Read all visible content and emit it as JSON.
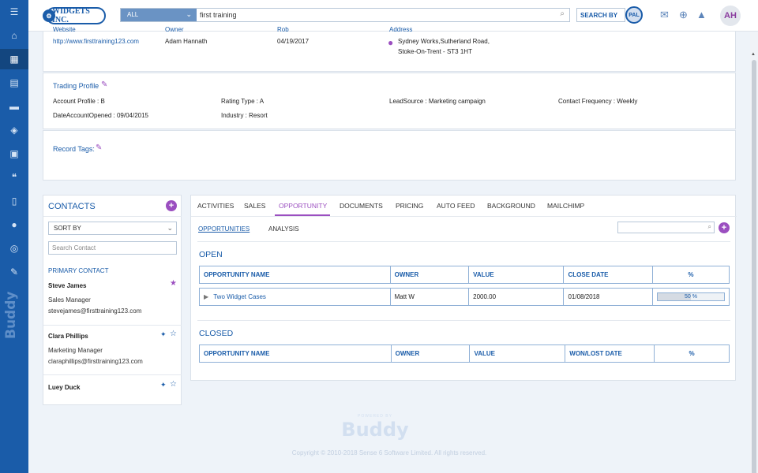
{
  "header": {
    "brand": "WIDGETS INC.",
    "search_scope": "ALL",
    "search_value": "first training",
    "search_by_label": "SEARCH BY",
    "pal_label": "PAL",
    "user_initials": "AH"
  },
  "account": {
    "website_label": "Website",
    "website_value": "http://www.firsttraining123.com",
    "owner_label": "Owner",
    "owner_value": "Adam Hannath",
    "rob_label": "Rob",
    "rob_value": "04/19/2017",
    "address_label": "Address",
    "address_line1": "Sydney Works,Sutherland Road,",
    "address_line2": "Stoke-On-Trent - ST3 1HT"
  },
  "trading_profile": {
    "title": "Trading Profile",
    "account_profile_label": "Account Profile :",
    "account_profile_value": "B",
    "rating_type_label": "Rating Type :",
    "rating_type_value": "A",
    "lead_source_label": "LeadSource :",
    "lead_source_value": "Marketing campaign",
    "contact_frequency_label": "Contact Frequency :",
    "contact_frequency_value": "Weekly",
    "date_opened_label": "DateAccountOpened :",
    "date_opened_value": "09/04/2015",
    "industry_label": "Industry :",
    "industry_value": "Resort"
  },
  "record_tags": {
    "title": "Record Tags:"
  },
  "contacts": {
    "title": "CONTACTS",
    "sort_by": "SORT BY",
    "search_placeholder": "Search Contact",
    "primary_label": "PRIMARY CONTACT",
    "items": [
      {
        "name": "Steve James",
        "role": "Sales Manager",
        "email": "stevejames@firsttraining123.com"
      },
      {
        "name": "Clara Phillips",
        "role": "Marketing Manager",
        "email": "claraphillips@firsttraining123.com"
      },
      {
        "name": "Luey Duck"
      }
    ]
  },
  "tabs": [
    {
      "label": "ACTIVITIES"
    },
    {
      "label": "SALES"
    },
    {
      "label": "OPPORTUNITY"
    },
    {
      "label": "DOCUMENTS"
    },
    {
      "label": "PRICING"
    },
    {
      "label": "AUTO FEED"
    },
    {
      "label": "BACKGROUND"
    },
    {
      "label": "MAILCHIMP"
    }
  ],
  "subtabs": [
    {
      "label": "OPPORTUNITIES"
    },
    {
      "label": "ANALYSIS"
    }
  ],
  "open": {
    "title": "OPEN",
    "columns": [
      "OPPORTUNITY NAME",
      "OWNER",
      "VALUE",
      "CLOSE DATE",
      "%"
    ],
    "rows": [
      {
        "name": "Two Widget Cases",
        "owner": "Matt W",
        "value": "2000.00",
        "close_date": "01/08/2018",
        "percent_label": "50 %",
        "percent": 50
      }
    ]
  },
  "closed": {
    "title": "CLOSED",
    "columns": [
      "OPPORTUNITY NAME",
      "OWNER",
      "VALUE",
      "WON/LOST DATE",
      "%"
    ]
  },
  "footer": {
    "powered_by": "POWERED BY",
    "logo_text": "Buddy",
    "copyright": "Copyright © 2010-2018 Sense 6 Software Limited. All rights reserved."
  },
  "colors": {
    "primary": "#1a5ca9",
    "accent": "#9b4fc0",
    "rail": "#1a5ca9"
  }
}
